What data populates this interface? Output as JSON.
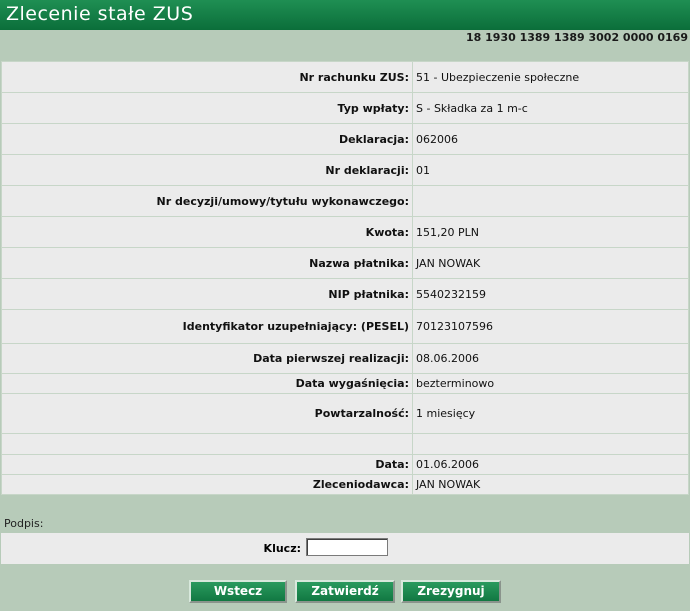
{
  "header": {
    "title": "Zlecenie stałe ZUS",
    "account_number": "18 1930 1389 1389 3002 0000 0169"
  },
  "fields": [
    {
      "label": "Nr rachunku ZUS:",
      "value": "51 - Ubezpieczenie społeczne"
    },
    {
      "label": "Typ wpłaty:",
      "value": "S - Składka za 1 m-c"
    },
    {
      "label": "Deklaracja:",
      "value": "062006"
    },
    {
      "label": "Nr deklaracji:",
      "value": "01"
    },
    {
      "label": "Nr decyzji/umowy/tytułu wykonawczego:",
      "value": ""
    },
    {
      "label": "Kwota:",
      "value": "151,20 PLN"
    },
    {
      "label": "Nazwa płatnika:",
      "value": "JAN NOWAK"
    },
    {
      "label": "NIP płatnika:",
      "value": "5540232159"
    },
    {
      "label": "Identyfikator uzupełniający: (PESEL)",
      "value": "70123107596"
    },
    {
      "label": "Data pierwszej realizacji:",
      "value": "08.06.2006"
    },
    {
      "label": "Data wygaśnięcia:",
      "value": "bezterminowo"
    },
    {
      "label": "Powtarzalność:",
      "value": "1 miesięcy"
    },
    {
      "label": "",
      "value": ""
    },
    {
      "label": "Data:",
      "value": "01.06.2006"
    },
    {
      "label": "Zleceniodawca:",
      "value": "JAN NOWAK"
    }
  ],
  "signature": {
    "section_label": "Podpis:",
    "key_label": "Klucz:",
    "key_value": ""
  },
  "buttons": {
    "back": "Wstecz",
    "confirm": "Zatwierdź",
    "cancel": "Zrezygnuj"
  }
}
